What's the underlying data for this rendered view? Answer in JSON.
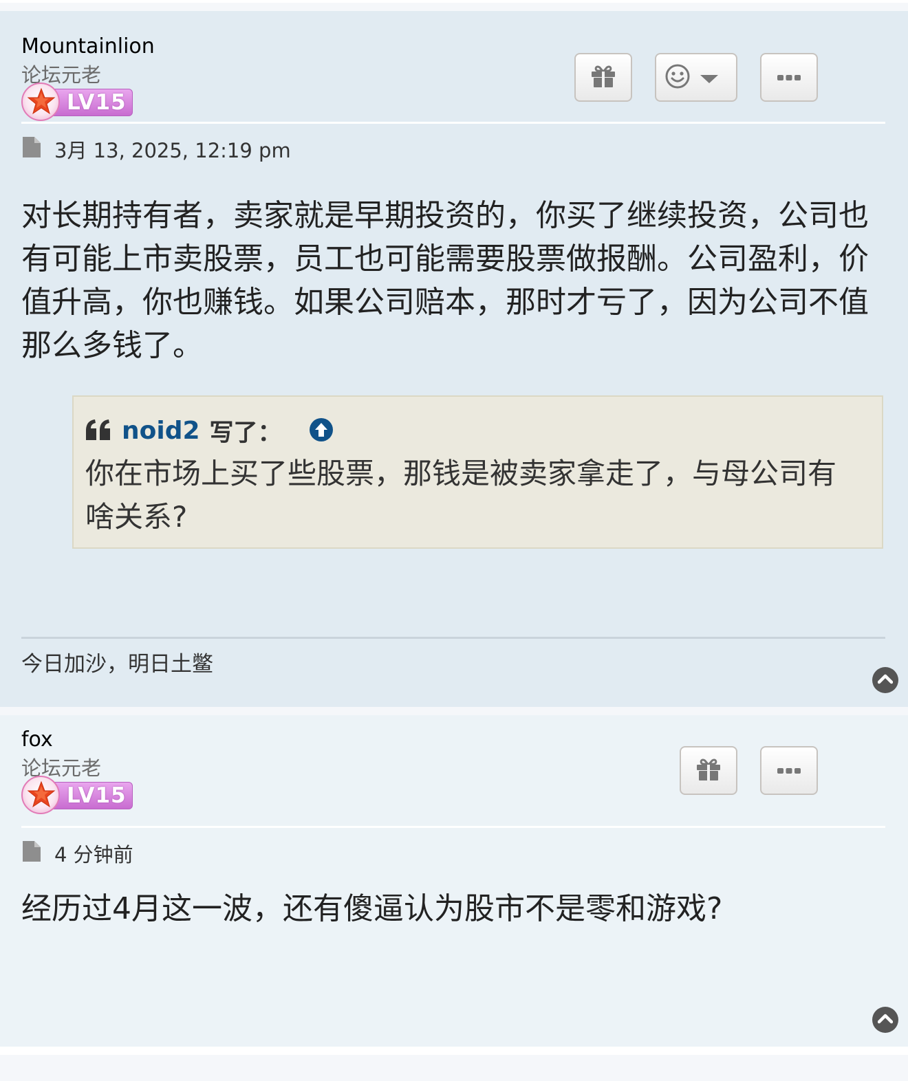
{
  "posts": [
    {
      "username": "Mountainlion",
      "rank": "论坛元老",
      "level": "LV15",
      "date": "3月 13, 2025, 12:19 pm",
      "content": "对长期持有者，卖家就是早期投资的，你买了继续投资，公司也有可能上市卖股票，员工也可能需要股票做报酬。公司盈利，价值升高，你也赚钱。如果公司赔本，那时才亏了，因为公司不值那么多钱了。",
      "quote": {
        "author": "noid2",
        "wrote": "写了：",
        "text": "你在市场上买了些股票，那钱是被卖家拿走了，与母公司有啥关系?"
      },
      "signature": "今日加沙，明日土鳖",
      "buttons": [
        "gift-icon",
        "smiley-icon",
        "more-icon"
      ]
    },
    {
      "username": "fox",
      "rank": "论坛元老",
      "level": "LV15",
      "date": "4 分钟前",
      "content": "经历过4月这一波，还有傻逼认为股市不是零和游戏?",
      "buttons": [
        "gift-icon",
        "more-icon"
      ]
    }
  ],
  "colors": {
    "post_bg_1": "#e1ebf2",
    "post_bg_2": "#ecf3f7",
    "quote_bg": "#ebe9de",
    "quote_author": "#105289",
    "level_badge": "#c86cd0"
  }
}
